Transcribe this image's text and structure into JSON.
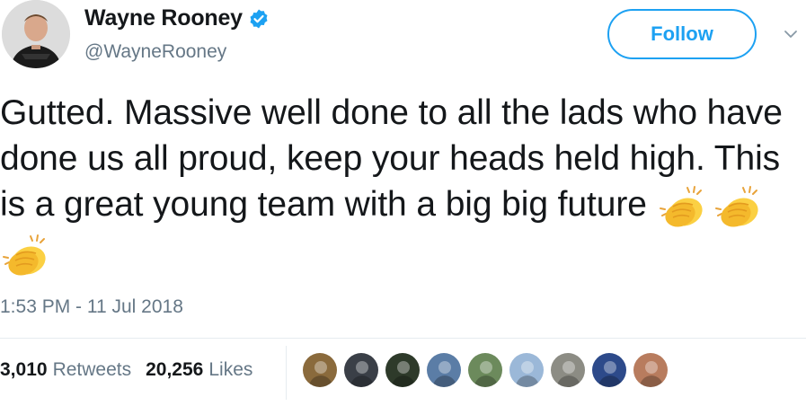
{
  "author": {
    "display_name": "Wayne Rooney",
    "handle": "@WayneRooney",
    "verified": true,
    "avatar_icon": "profile-photo"
  },
  "follow_button": {
    "label": "Follow"
  },
  "menu": {
    "icon": "chevron-down-icon"
  },
  "tweet": {
    "text": "Gutted. Massive well done to all the lads who have done us all proud, keep your heads held high. This is a great young team with a big big future",
    "emoji": [
      "clapping-hands",
      "clapping-hands",
      "clapping-hands"
    ],
    "timestamp": "1:53 PM - 11 Jul 2018"
  },
  "stats": {
    "retweets": {
      "count": "3,010",
      "label": "Retweets"
    },
    "likes": {
      "count": "20,256",
      "label": "Likes"
    }
  },
  "likers": [
    {
      "color": "#8a6a3c"
    },
    {
      "color": "#3a3f47"
    },
    {
      "color": "#2e3a2a"
    },
    {
      "color": "#5b7da6"
    },
    {
      "color": "#6c8a5c"
    },
    {
      "color": "#9bb8d8"
    },
    {
      "color": "#8c8c84"
    },
    {
      "color": "#2d4a8a"
    },
    {
      "color": "#b87c5e"
    }
  ],
  "colors": {
    "brand_blue": "#1da1f2",
    "secondary_text": "#657786",
    "primary_text": "#14171a"
  }
}
